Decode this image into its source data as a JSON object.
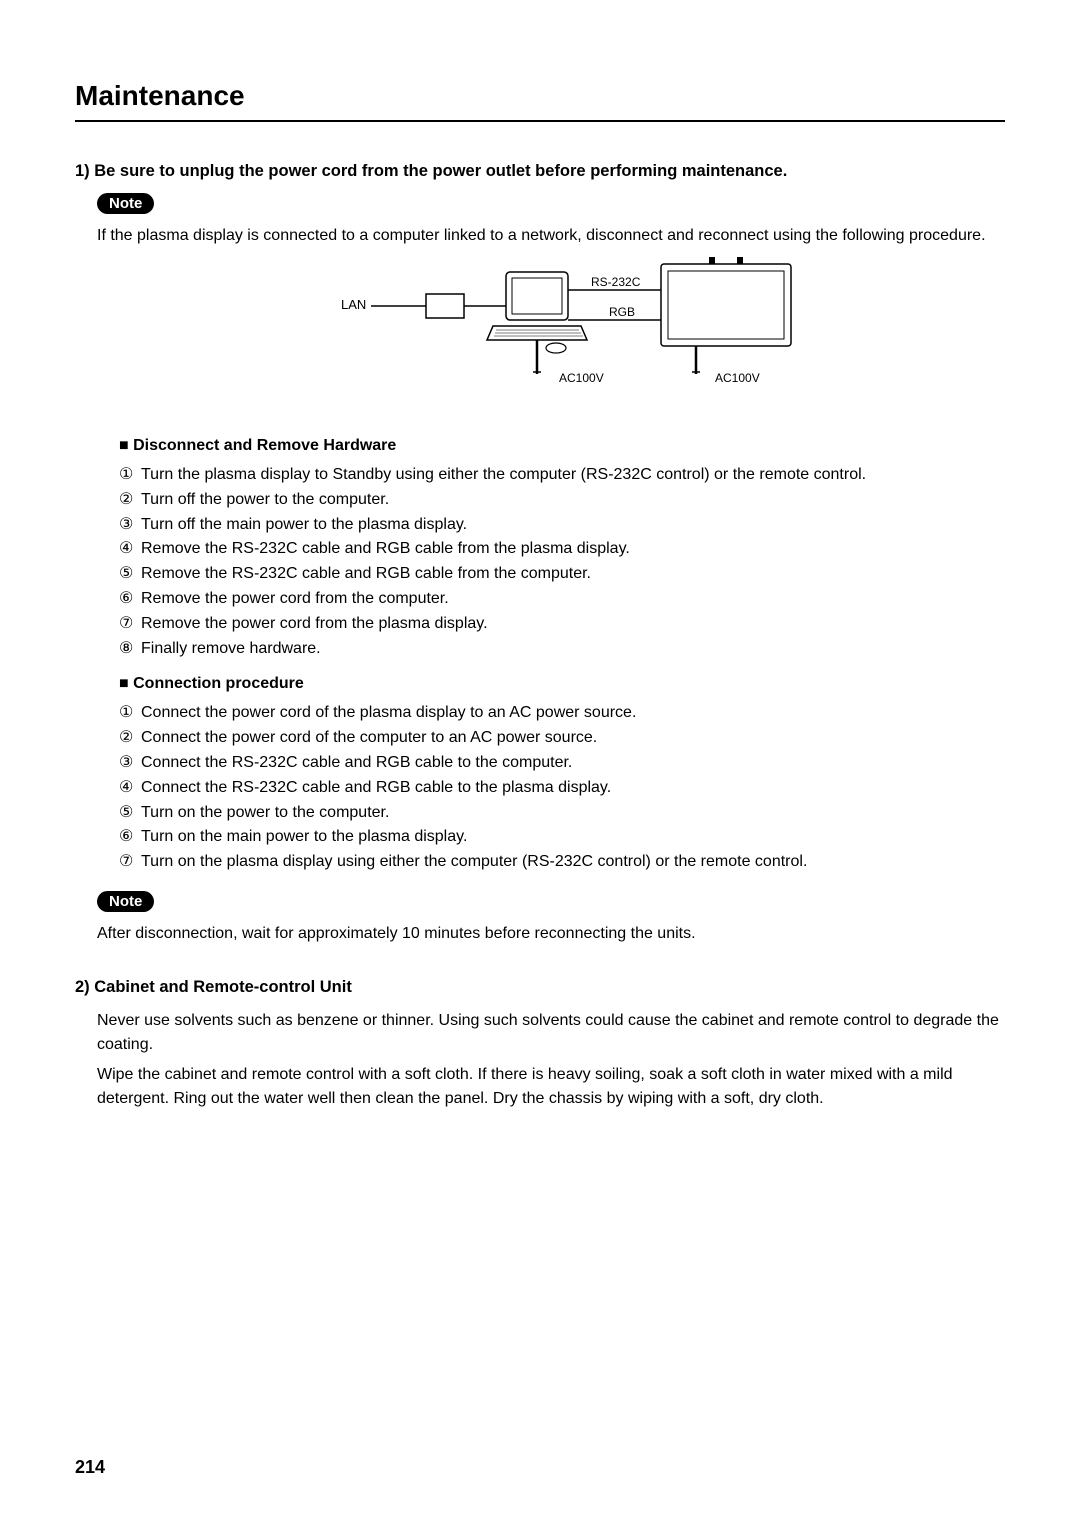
{
  "title": "Maintenance",
  "section1": {
    "heading": "1) Be sure to unplug the power cord from the power outlet before performing maintenance.",
    "noteLabel": "Note",
    "noteText": "If the plasma display is connected to a computer linked to a network, disconnect and reconnect using the following procedure.",
    "diagram": {
      "lan": "LAN",
      "rs232c": "RS-232C",
      "rgb": "RGB",
      "ac1": "AC100V",
      "ac2": "AC100V"
    },
    "disconnect": {
      "heading": "■ Disconnect and Remove Hardware",
      "steps": [
        "Turn the plasma display to Standby using either the computer (RS-232C control) or the remote control.",
        "Turn off the power to the computer.",
        "Turn off the main power to the plasma display.",
        "Remove the RS-232C cable and RGB cable from the plasma display.",
        "Remove the RS-232C cable and RGB cable from the computer.",
        "Remove the power cord from the computer.",
        "Remove the power cord from the plasma display.",
        "Finally remove hardware."
      ]
    },
    "connect": {
      "heading": "■ Connection procedure",
      "steps": [
        "Connect the power cord of the plasma display to an AC power source.",
        "Connect the power cord of the computer to an AC power source.",
        "Connect the RS-232C cable and RGB cable to the computer.",
        "Connect the RS-232C cable and RGB cable to the plasma display.",
        "Turn on the power to the computer.",
        "Turn on the main power to the plasma display.",
        "Turn on the plasma display using either the computer (RS-232C control) or the remote control."
      ]
    },
    "note2Label": "Note",
    "note2Text": "After disconnection, wait for approximately 10 minutes before reconnecting the units."
  },
  "section2": {
    "heading": "2) Cabinet and Remote-control Unit",
    "p1": "Never use solvents such as benzene or thinner. Using such solvents could cause the cabinet and remote control to degrade the coating.",
    "p2": "Wipe the cabinet and remote control with a soft cloth. If there is heavy soiling, soak a soft cloth in water mixed with a mild detergent. Ring out the water well then clean the panel. Dry the chassis by wiping with a soft, dry cloth."
  },
  "pageNumber": "214",
  "circledNums": [
    "①",
    "②",
    "③",
    "④",
    "⑤",
    "⑥",
    "⑦",
    "⑧"
  ]
}
